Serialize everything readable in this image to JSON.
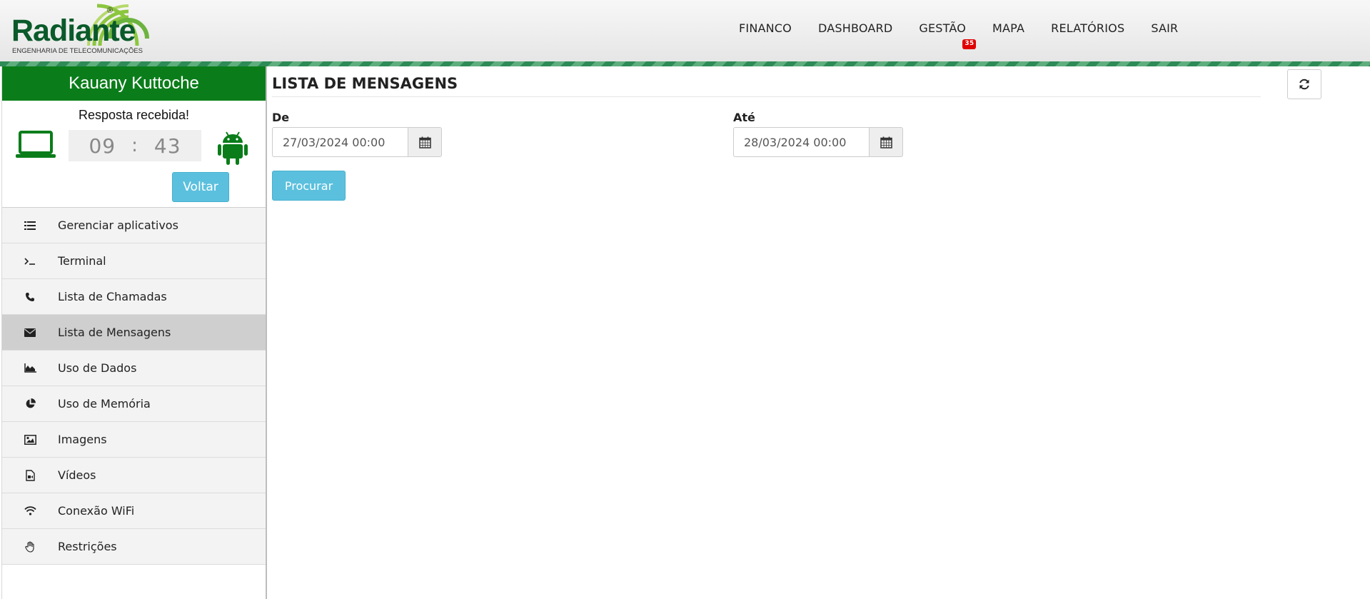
{
  "header": {
    "logo": {
      "word": "Radiante",
      "subtitle": "ENGENHARIA DE TELECOMUNICAÇÕES",
      "reg": "®"
    },
    "nav": [
      {
        "label": "FINANCO"
      },
      {
        "label": "DASHBOARD"
      },
      {
        "label": "GESTÃO",
        "badge": "35"
      },
      {
        "label": "MAPA"
      },
      {
        "label": "RELATÓRIOS"
      },
      {
        "label": "SAIR"
      }
    ]
  },
  "sidebar": {
    "user_name": "Kauany Kuttoche",
    "status": "Resposta recebida!",
    "timer": {
      "hours": "09",
      "separator": ":",
      "minutes": "43"
    },
    "back_label": "Voltar",
    "menu": [
      {
        "label": "Gerenciar aplicativos",
        "icon": "list-icon"
      },
      {
        "label": "Terminal",
        "icon": "terminal-icon"
      },
      {
        "label": "Lista de Chamadas",
        "icon": "phone-icon"
      },
      {
        "label": "Lista de Mensagens",
        "icon": "envelope-icon",
        "active": true
      },
      {
        "label": "Uso de Dados",
        "icon": "area-chart-icon"
      },
      {
        "label": "Uso de Memória",
        "icon": "pie-chart-icon"
      },
      {
        "label": "Imagens",
        "icon": "image-icon"
      },
      {
        "label": "Vídeos",
        "icon": "video-file-icon"
      },
      {
        "label": "Conexão WiFi",
        "icon": "wifi-icon"
      },
      {
        "label": "Restrições",
        "icon": "hand-icon"
      }
    ]
  },
  "main": {
    "title": "LISTA DE MENSAGENS",
    "from": {
      "label": "De",
      "value": "27/03/2024 00:00"
    },
    "to": {
      "label": "Até",
      "value": "28/03/2024 00:00"
    },
    "search_label": "Procurar"
  },
  "colors": {
    "brand_green": "#0a7d1a",
    "button_blue": "#5bc0de",
    "badge_red": "#e00000",
    "active_menu": "#cfcfcf"
  }
}
